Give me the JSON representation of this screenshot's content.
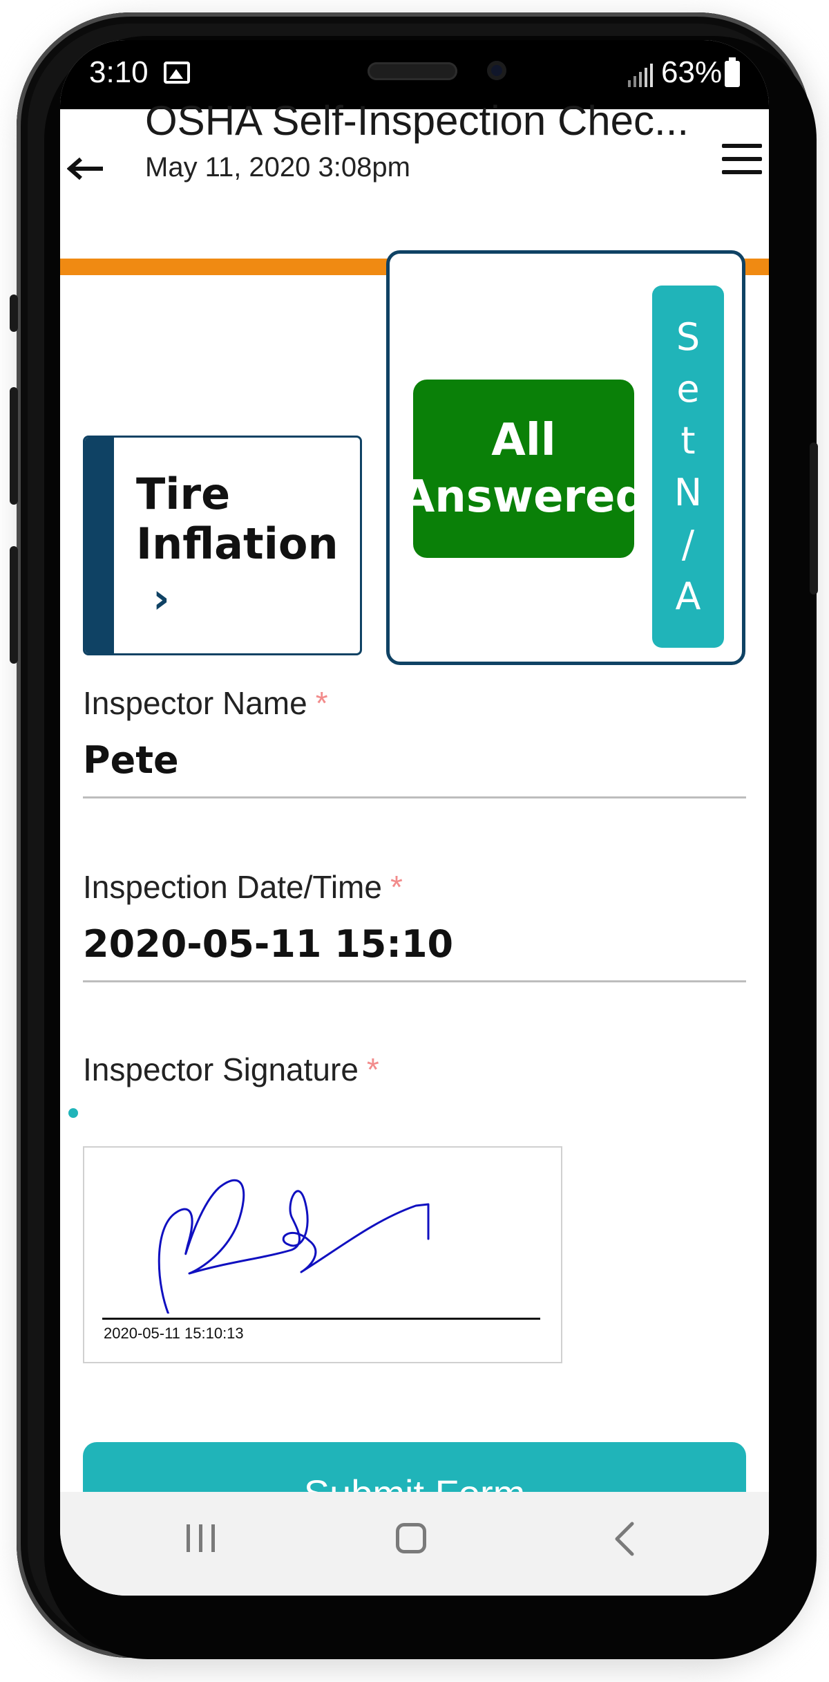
{
  "status_bar": {
    "time": "3:10",
    "battery": "63%"
  },
  "app_bar": {
    "title": "OSHA Self-Inspection Chec...",
    "subtitle": "May 11, 2020 3:08pm"
  },
  "section_card": {
    "title_line1": "Tire",
    "title_line2": "Inflation",
    "chevron": "›"
  },
  "status_card": {
    "answered_line1": "All",
    "answered_line2": "Answered",
    "set_na_letters": [
      "S",
      "e",
      "t",
      "N",
      "/",
      "A"
    ]
  },
  "fields": {
    "inspector_name": {
      "label": "Inspector Name",
      "required": "*",
      "value": "Pete"
    },
    "inspection_datetime": {
      "label": "Inspection Date/Time",
      "required": "*",
      "value": "2020-05-11 15:10"
    },
    "inspector_signature": {
      "label": "Inspector Signature",
      "required": "*",
      "timestamp": "2020-05-11 15:10:13"
    }
  },
  "submit": {
    "label": "Submit Form"
  },
  "colors": {
    "orange_accent": "#f08a12",
    "navy": "#0f4264",
    "green_answered": "#0a8008",
    "teal": "#20b4b9",
    "required_star": "#f28b8b",
    "signature_ink": "#1010c0"
  }
}
